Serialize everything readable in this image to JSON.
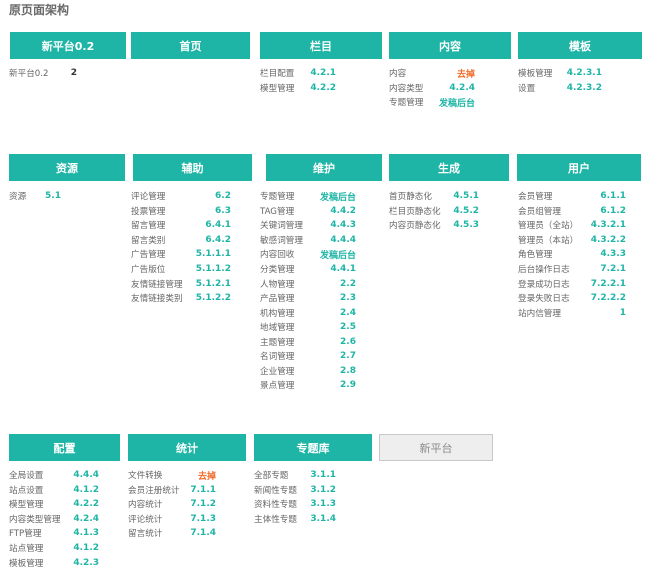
{
  "page_title": "原页面架构",
  "colors": {
    "accent": "#1fb5a6",
    "orange": "#f26b2a",
    "gray_box": "#eeeeee"
  },
  "sections": [
    {
      "id": "new-platform-02",
      "title": "新平台0.2",
      "items": [
        {
          "label": "新平台0.2",
          "code": "2",
          "style": "dark"
        }
      ]
    },
    {
      "id": "home",
      "title": "首页",
      "items": []
    },
    {
      "id": "column",
      "title": "栏目",
      "items": [
        {
          "label": "栏目配置",
          "code": "4.2.1"
        },
        {
          "label": "模型管理",
          "code": "4.2.2"
        }
      ]
    },
    {
      "id": "content",
      "title": "内容",
      "items": [
        {
          "label": "内容",
          "code": "去掉",
          "style": "orange"
        },
        {
          "label": "内容类型",
          "code": "4.2.4"
        },
        {
          "label": "专题管理",
          "code": "发稿后台"
        }
      ]
    },
    {
      "id": "template",
      "title": "模板",
      "items": [
        {
          "label": "模板管理",
          "code": "4.2.3.1"
        },
        {
          "label": "设置",
          "code": "4.2.3.2"
        }
      ]
    },
    {
      "id": "resource",
      "title": "资源",
      "items": [
        {
          "label": "资源",
          "code": "5.1"
        }
      ]
    },
    {
      "id": "auxiliary",
      "title": "辅助",
      "items": [
        {
          "label": "评论管理",
          "code": "6.2"
        },
        {
          "label": "投票管理",
          "code": "6.3"
        },
        {
          "label": "留言管理",
          "code": "6.4.1"
        },
        {
          "label": "留言类别",
          "code": "6.4.2"
        },
        {
          "label": "广告管理",
          "code": "5.1.1.1"
        },
        {
          "label": "广告版位",
          "code": "5.1.1.2"
        },
        {
          "label": "友情链接管理",
          "code": "5.1.2.1"
        },
        {
          "label": "友情链接类别",
          "code": "5.1.2.2"
        }
      ]
    },
    {
      "id": "maintenance",
      "title": "维护",
      "items": [
        {
          "label": "专题管理",
          "code": "发稿后台"
        },
        {
          "label": "TAG管理",
          "code": "4.4.2"
        },
        {
          "label": "关键词管理",
          "code": "4.4.3"
        },
        {
          "label": "敏感词管理",
          "code": "4.4.4"
        },
        {
          "label": "内容回收",
          "code": "发稿后台"
        },
        {
          "label": "分类管理",
          "code": "4.4.1"
        },
        {
          "label": "人物管理",
          "code": "2.2"
        },
        {
          "label": "产品管理",
          "code": "2.3"
        },
        {
          "label": "机构管理",
          "code": "2.4"
        },
        {
          "label": "地域管理",
          "code": "2.5"
        },
        {
          "label": "主题管理",
          "code": "2.6"
        },
        {
          "label": "名词管理",
          "code": "2.7"
        },
        {
          "label": "企业管理",
          "code": "2.8"
        },
        {
          "label": "景点管理",
          "code": "2.9"
        }
      ]
    },
    {
      "id": "generate",
      "title": "生成",
      "items": [
        {
          "label": "首页静态化",
          "code": "4.5.1"
        },
        {
          "label": "栏目页静态化",
          "code": "4.5.2"
        },
        {
          "label": "内容页静态化",
          "code": "4.5.3"
        }
      ]
    },
    {
      "id": "user",
      "title": "用户",
      "items": [
        {
          "label": "会员管理",
          "code": "6.1.1"
        },
        {
          "label": "会员组管理",
          "code": "6.1.2"
        },
        {
          "label": "管理员（全站）",
          "code": "4.3.2.1"
        },
        {
          "label": "管理员（本站）",
          "code": "4.3.2.2"
        },
        {
          "label": "角色管理",
          "code": "4.3.3"
        },
        {
          "label": "后台操作日志",
          "code": "7.2.1"
        },
        {
          "label": "登录成功日志",
          "code": "7.2.2.1"
        },
        {
          "label": "登录失败日志",
          "code": "7.2.2.2"
        },
        {
          "label": "站内信管理",
          "code": "1"
        }
      ]
    },
    {
      "id": "config",
      "title": "配置",
      "items": [
        {
          "label": "全局设置",
          "code": "4.4.4"
        },
        {
          "label": "站点设置",
          "code": "4.1.2"
        },
        {
          "label": "模型管理",
          "code": "4.2.2"
        },
        {
          "label": "内容类型管理",
          "code": "4.2.4"
        },
        {
          "label": "FTP管理",
          "code": "4.1.3"
        },
        {
          "label": "站点管理",
          "code": "4.1.2"
        },
        {
          "label": "模板管理",
          "code": "4.2.3"
        }
      ]
    },
    {
      "id": "statistics",
      "title": "统计",
      "items": [
        {
          "label": "文件转换",
          "code": "去掉",
          "style": "orange"
        },
        {
          "label": "会员注册统计",
          "code": "7.1.1"
        },
        {
          "label": "内容统计",
          "code": "7.1.2"
        },
        {
          "label": "评论统计",
          "code": "7.1.3"
        },
        {
          "label": "留言统计",
          "code": "7.1.4"
        }
      ]
    },
    {
      "id": "special-library",
      "title": "专题库",
      "items": [
        {
          "label": "全部专题",
          "code": "3.1.1"
        },
        {
          "label": "新闻性专题",
          "code": "3.1.2"
        },
        {
          "label": "资料性专题",
          "code": "3.1.3"
        },
        {
          "label": "主体性专题",
          "code": "3.1.4"
        }
      ]
    },
    {
      "id": "new-platform",
      "title": "新平台",
      "style": "gray",
      "items": []
    }
  ]
}
